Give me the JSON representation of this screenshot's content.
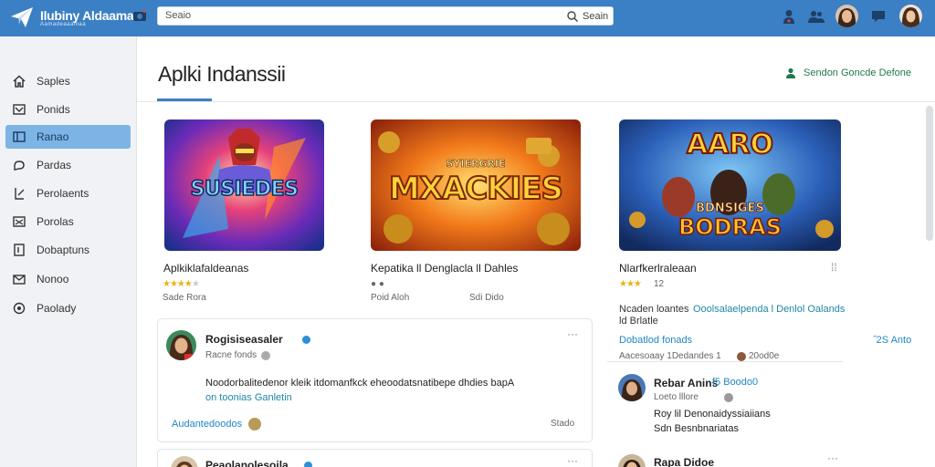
{
  "header": {
    "brand": "Ilubiny Aldaama",
    "brand_sub": "Aamadeaaamaa",
    "search_placeholder": "Seaio",
    "search_button": "Seain"
  },
  "sidebar": {
    "items": [
      {
        "label": "Saples",
        "icon": "home-icon"
      },
      {
        "label": "Ponids",
        "icon": "inbox-icon"
      },
      {
        "label": "Ranao",
        "icon": "folder-icon",
        "active": true
      },
      {
        "label": "Pardas",
        "icon": "chat-icon"
      },
      {
        "label": "Perolaents",
        "icon": "edit-icon"
      },
      {
        "label": "Porolas",
        "icon": "image-icon"
      },
      {
        "label": "Dobaptuns",
        "icon": "document-icon"
      },
      {
        "label": "Nonoo",
        "icon": "mail-icon"
      },
      {
        "label": "Paolady",
        "icon": "settings-icon"
      }
    ]
  },
  "main": {
    "title": "Aplki Indanssii",
    "section_link": "Sendon Goncde Defone",
    "games": [
      {
        "art_text": "SUSIEDES",
        "title": "Aplkiklafaldeanas",
        "rating": 4,
        "meta_left": "Sade Rora",
        "meta_right": ""
      },
      {
        "art_text": "MXACKIES",
        "art_top": "SYIERGRIE",
        "title": "Kepatika ll Denglacla ll Dahles",
        "rating": 0,
        "meta_left": "Poid Aloh",
        "meta_right": "Sdi Dido"
      },
      {
        "art_text": "BODRAS",
        "art_top": "AARO",
        "art_mid": "BDNSIGES",
        "title": "Nlarfkerlraleaan",
        "rating": 3,
        "meta_left": "12",
        "meta_right": ""
      }
    ],
    "posts": [
      {
        "author": "Rogisiseasaler",
        "sub": "Racne fonds",
        "body": "Noodorbalitedenor kleik itdomanfkck eheoodatsnatibepe dhdies bapA",
        "link": "on toonias Ganletin",
        "footer_link": "Audantedoodos",
        "footer_right": "Stado",
        "dots": "···"
      },
      {
        "author": "Peaolanolesoila",
        "dots": "···"
      }
    ],
    "right_panel": {
      "line1": "Ncaden loantes",
      "line1_link": "Ooolsalaelpenda l Denlol Oalands",
      "line2": "ld Brlatle",
      "link_left": "Dobatlod fonads",
      "link_right": "˝2S Anto",
      "meta": "Aacesoaay 1Dedandes 1",
      "meta_num": "20od0e",
      "comment_author": "Rebar Anins",
      "comment_author_link": "f5 Boodo0",
      "comment_sub": "Loeto lllore",
      "comment_body1": "Roy lil Denonaidyssiaiians",
      "comment_body2": "Sdn Besnbnariatas",
      "bottom_author": "Rapa Didoe"
    }
  },
  "colors": {
    "topbar": "#3b7fc4",
    "active_nav": "#7db4e6",
    "accent_link": "#1f86c6",
    "star": "#e6b318"
  }
}
